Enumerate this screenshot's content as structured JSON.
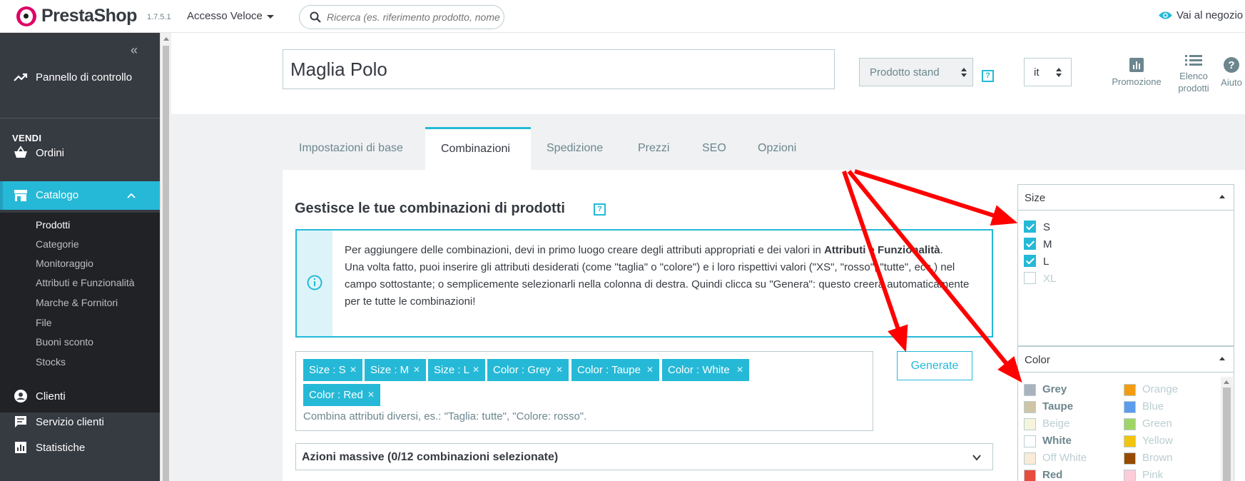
{
  "header": {
    "brand": "PrestaShop",
    "version": "1.7.5.1",
    "quick_access": "Accesso Veloce",
    "search_placeholder": "Ricerca (es. riferimento prodotto, nome",
    "view_shop": "Vai al negozio"
  },
  "sidebar": {
    "dashboard": "Pannello di controllo",
    "section": "VENDI",
    "orders": "Ordini",
    "catalog": "Catalogo",
    "catalog_items": [
      "Prodotti",
      "Categorie",
      "Monitoraggio",
      "Attributi e Funzionalità",
      "Marche & Fornitori",
      "File",
      "Buoni sconto",
      "Stocks"
    ],
    "customers": "Clienti",
    "customer_service": "Servizio clienti",
    "stats": "Statistiche"
  },
  "product": {
    "name": "Maglia Polo",
    "type": "Prodotto stand",
    "lang": "it",
    "help": "?"
  },
  "toolbar": {
    "promotion": "Promozione",
    "list_line1": "Elenco",
    "list_line2": "prodotti",
    "help": "Aiuto"
  },
  "tabs": [
    "Impostazioni di base",
    "Combinazioni",
    "Spedizione",
    "Prezzi",
    "SEO",
    "Opzioni"
  ],
  "combinations": {
    "title": "Gestisce le tue combinazioni di prodotti",
    "info_part1": "Per aggiungere delle combinazioni, devi in primo luogo creare degli attributi appropriati e dei valori in ",
    "info_bold": "Attributi e Funzionalità",
    "info_part2": ".",
    "info_line2": "Una volta fatto, puoi inserire gli attributi desiderati (come \"taglia\" o \"colore\") e i loro rispettivi valori (\"XS\", \"rosso\", \"tutte\", ecc.) nel campo sottostante; o semplicemente selezionarli nella colonna di destra. Quindi clicca su \"Genera\": questo creerà automaticamente per te tutte le combinazioni!",
    "tags": [
      "Size : S",
      "Size : M",
      "Size : L",
      "Color : Grey",
      "Color : Taupe",
      "Color : White",
      "Color : Red"
    ],
    "hint": "Combina attributi diversi, es.: \"Taglia: tutte\", \"Colore: rosso\".",
    "generate": "Generate",
    "bulk": "Azioni massive (0/12 combinazioni selezionate)"
  },
  "size_panel": {
    "title": "Size",
    "options": [
      {
        "label": "S",
        "checked": true
      },
      {
        "label": "M",
        "checked": true
      },
      {
        "label": "L",
        "checked": true
      },
      {
        "label": "XL",
        "checked": false
      }
    ]
  },
  "color_panel": {
    "title": "Color",
    "left": [
      {
        "label": "Grey",
        "color": "#aab2bd",
        "selected": true
      },
      {
        "label": "Taupe",
        "color": "#cfc4a6",
        "selected": true
      },
      {
        "label": "Beige",
        "color": "#f5f5dc",
        "selected": false
      },
      {
        "label": "White",
        "color": "#ffffff",
        "selected": true
      },
      {
        "label": "Off White",
        "color": "#faebd7",
        "selected": false
      },
      {
        "label": "Red",
        "color": "#e84c3d",
        "selected": true
      }
    ],
    "right": [
      {
        "label": "Orange",
        "color": "#f39c11",
        "selected": false
      },
      {
        "label": "Blue",
        "color": "#5d9cec",
        "selected": false
      },
      {
        "label": "Green",
        "color": "#a0d468",
        "selected": false
      },
      {
        "label": "Yellow",
        "color": "#f1c40f",
        "selected": false
      },
      {
        "label": "Brown",
        "color": "#964b00",
        "selected": false
      },
      {
        "label": "Pink",
        "color": "#fcccd9",
        "selected": false
      }
    ]
  },
  "colors": {
    "accent": "#25b9d7",
    "sidebar": "#363a41",
    "annotation": "#ff0000"
  }
}
